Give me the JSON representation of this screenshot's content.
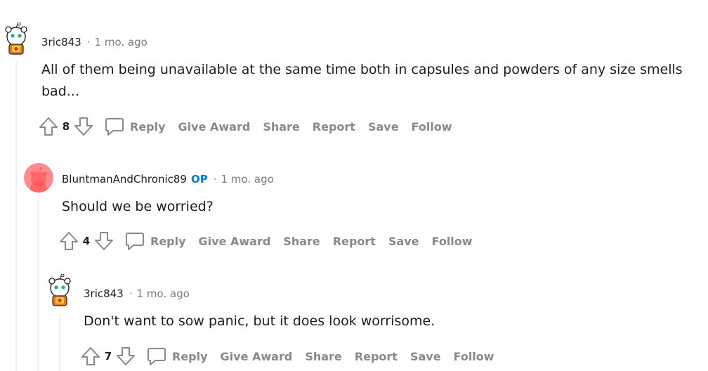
{
  "comments": [
    {
      "author": "3ric843",
      "op_badge": "",
      "separator": "·",
      "time": "1 mo. ago",
      "body": "All of them being unavailable at the same time both in capsules and powders of any size smells bad...",
      "votes": "8"
    },
    {
      "author": "BluntmanAndChronic89",
      "op_badge": "OP",
      "separator": "·",
      "time": "1 mo. ago",
      "body": "Should we be worried?",
      "votes": "4"
    },
    {
      "author": "3ric843",
      "op_badge": "",
      "separator": "·",
      "time": "1 mo. ago",
      "body": "Don't want to sow panic, but it does look worrisome.",
      "votes": "7"
    }
  ],
  "actions": {
    "reply": "Reply",
    "give_award": "Give Award",
    "share": "Share",
    "report": "Report",
    "save": "Save",
    "follow": "Follow"
  },
  "icons": [
    "upvote-icon",
    "downvote-icon",
    "comment-bubble-icon"
  ],
  "colors": {
    "op": "#0079d3",
    "meta": "#7c7c7c",
    "action": "#878a8c",
    "thread": "#edeff1",
    "avatar_pink": "#ff585b"
  }
}
